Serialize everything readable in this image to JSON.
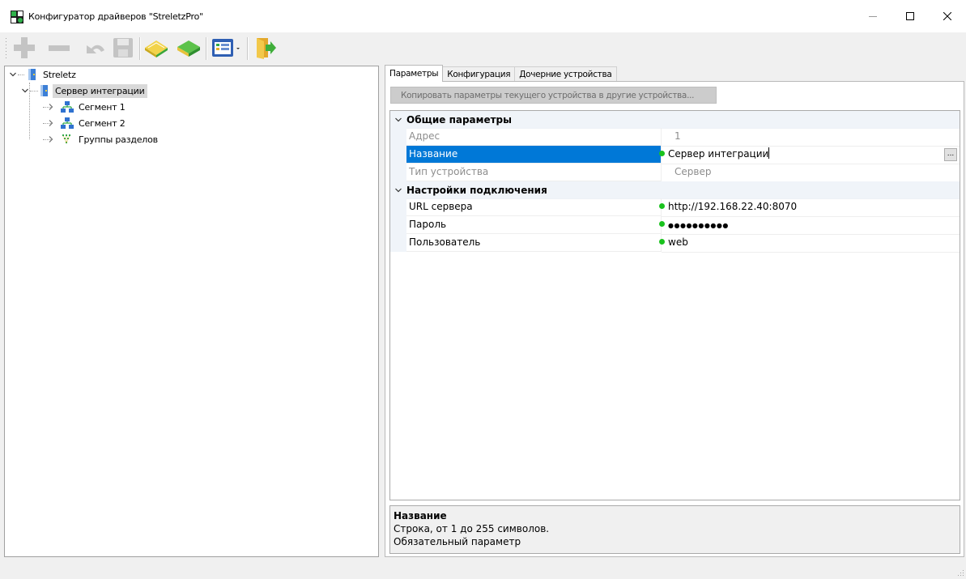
{
  "window": {
    "title": "Конфигуратор драйверов \"StreletzPro\"",
    "icon": "app-icon",
    "controls": [
      "minimize-icon",
      "maximize-icon",
      "close-icon"
    ]
  },
  "toolbar": {
    "buttons": [
      {
        "name": "add-device-button",
        "icon": "plus-icon",
        "enabled": false
      },
      {
        "name": "remove-device-button",
        "icon": "minus-icon",
        "enabled": false
      },
      {
        "name": "undo-button",
        "icon": "undo-icon",
        "enabled": false
      },
      {
        "name": "save-button",
        "icon": "floppy-icon",
        "enabled": false
      },
      {
        "name": "open-book-button",
        "icon": "open-book-icon",
        "enabled": true
      },
      {
        "name": "closed-book-button",
        "icon": "closed-book-icon",
        "enabled": true
      },
      {
        "name": "view-dropdown-button",
        "icon": "list-view-icon",
        "enabled": true
      },
      {
        "name": "exit-button",
        "icon": "exit-door-icon",
        "enabled": true
      }
    ]
  },
  "tree": {
    "root": {
      "label": "Streletz",
      "expanded": true
    },
    "server": {
      "label": "Сервер интеграции",
      "expanded": true,
      "selected": true
    },
    "children": [
      {
        "label": "Сегмент 1",
        "icon": "network-icon"
      },
      {
        "label": "Сегмент 2",
        "icon": "network-icon"
      },
      {
        "label": "Группы разделов",
        "icon": "groups-icon"
      }
    ]
  },
  "tabs": [
    {
      "label": "Параметры",
      "active": true
    },
    {
      "label": "Конфигурация",
      "active": false
    },
    {
      "label": "Дочерние устройства",
      "active": false
    }
  ],
  "copy_button_label": "Копировать параметры текущего устройства в другие устройства...",
  "property_grid": {
    "general": {
      "title": "Общие параметры",
      "address": {
        "name": "Адрес",
        "value": "1"
      },
      "name": {
        "name": "Название",
        "value": "Сервер интеграции"
      },
      "device_type": {
        "name": "Тип устройства",
        "value": "Сервер"
      }
    },
    "connection": {
      "title": "Настройки подключения",
      "url": {
        "name": "URL сервера",
        "value": "http://192.168.22.40:8070"
      },
      "password": {
        "name": "Пароль",
        "value": "●●●●●●●●●●"
      },
      "user": {
        "name": "Пользователь",
        "value": "web"
      }
    },
    "ellipsis_label": "...",
    "status_dot_color": "#19c21d",
    "selection_color": "#0078d7"
  },
  "description": {
    "title": "Название",
    "line1": "Строка, от 1 до 255 символов.",
    "line2": "Обязательный параметр"
  }
}
